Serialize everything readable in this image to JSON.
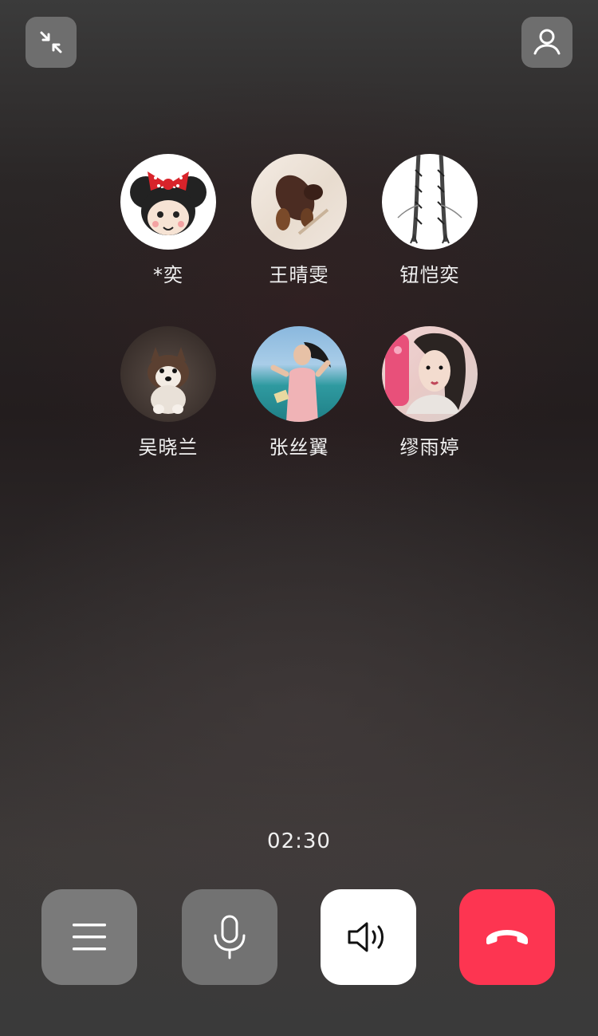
{
  "header": {
    "minimize_icon": "minimize-arrows-icon",
    "add_member_icon": "person-icon"
  },
  "members": [
    {
      "name": "*奕",
      "avatar": "mouse-cartoon-avatar"
    },
    {
      "name": "王晴雯",
      "avatar": "dog-photo-avatar"
    },
    {
      "name": "钮恺奕",
      "avatar": "braids-sketch-avatar"
    },
    {
      "name": "吴晓兰",
      "avatar": "husky-puppy-avatar"
    },
    {
      "name": "张丝翼",
      "avatar": "beach-girl-avatar"
    },
    {
      "name": "缪雨婷",
      "avatar": "selfie-girl-avatar"
    }
  ],
  "call": {
    "duration": "02:30"
  },
  "controls": {
    "menu_icon": "menu-icon",
    "mic_icon": "microphone-icon",
    "speaker_icon": "speaker-icon",
    "hangup_icon": "hang-up-icon",
    "speaker_active": true,
    "colors": {
      "hangup": "#fd3551",
      "speaker_bg": "#ffffff",
      "inactive_bg": "#777777"
    }
  }
}
